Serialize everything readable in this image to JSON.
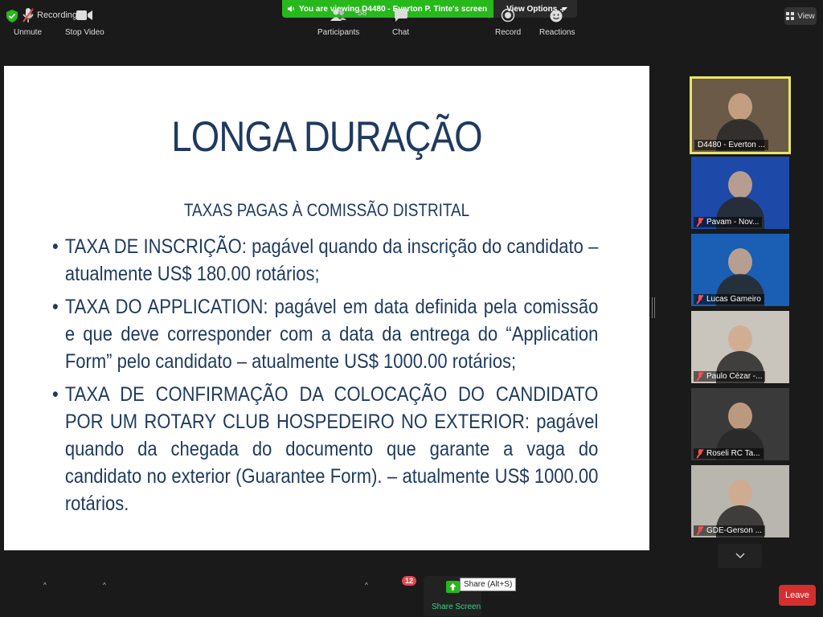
{
  "topbar": {
    "recording_label": "Recording",
    "viewing_label": "You are viewing D4480 - Everton P. Tinte's screen",
    "view_options_label": "View Options",
    "view_label": "View"
  },
  "slide": {
    "title": "LONGA DURAÇÃO",
    "subtitle": "TAXAS PAGAS À COMISSÃO DISTRITAL",
    "bullets": [
      "TAXA DE INSCRIÇÃO: pagável quando da inscrição do candidato – atualmente US$ 180.00 rotários;",
      "TAXA DO APPLICATION: pagável em data definida pela comissão e que deve corresponder com a data da entrega do “Application Form” pelo candidato – atualmente US$ 1000.00 rotários;",
      "TAXA DE CONFIRMAÇÃO DA COLOCAÇÃO DO CANDIDATO POR UM ROTARY CLUB HOSPEDEIRO NO EXTERIOR: pagável quando da chegada do documento que garante a vaga do candidato no exterior (Guarantee Form). – atualmente US$ 1000.00 rotários."
    ]
  },
  "participants_panel": {
    "tiles": [
      {
        "name": "D4480 - Everton ...",
        "muted": false,
        "active": true,
        "bg": "#6b5a48"
      },
      {
        "name": "Pavam - Nov...",
        "muted": true,
        "active": false,
        "bg": "#1d4aa8"
      },
      {
        "name": "Lucas Gameiro",
        "muted": true,
        "active": false,
        "bg": "#1a5fb4"
      },
      {
        "name": "Paulo Cézar -...",
        "muted": true,
        "active": false,
        "bg": "#c9c4bc"
      },
      {
        "name": "Roseli RC Ta...",
        "muted": true,
        "active": false,
        "bg": "#3a3a3a"
      },
      {
        "name": "GDE-Gerson ...",
        "muted": true,
        "active": false,
        "bg": "#b8b6ae"
      }
    ]
  },
  "toolbar": {
    "unmute_label": "Unmute",
    "stop_video_label": "Stop Video",
    "participants_label": "Participants",
    "participants_count": "58",
    "chat_label": "Chat",
    "chat_badge": "12",
    "share_label": "Share Screen",
    "share_tooltip": "Share (Alt+S)",
    "record_label": "Record",
    "reactions_label": "Reactions",
    "leave_label": "Leave"
  },
  "colors": {
    "accent_green": "#27b81c",
    "leave_red": "#d32f2f",
    "slide_text": "#1f3a5f",
    "active_border": "#e9e46a"
  }
}
